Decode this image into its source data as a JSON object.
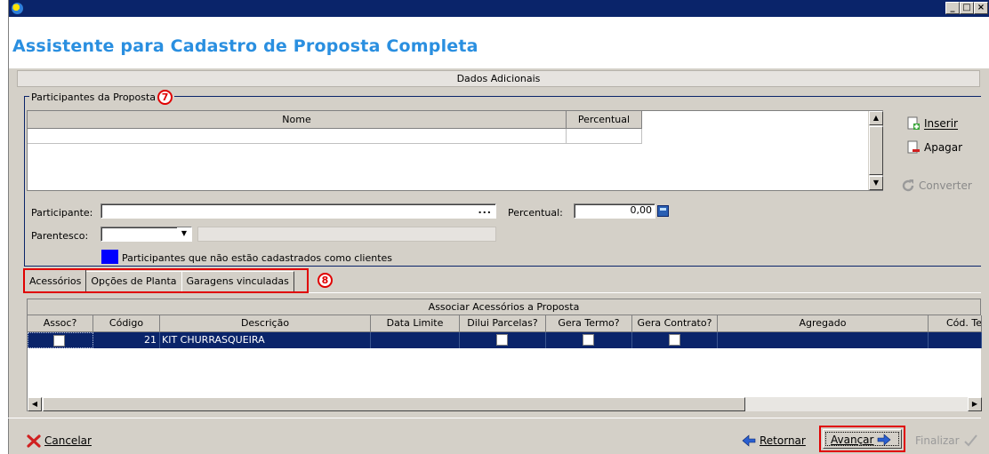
{
  "window": {
    "title": "Assistente para Cadastro de Proposta Completa",
    "controls": [
      "_",
      "□",
      "×"
    ]
  },
  "section": {
    "title": "Dados Adicionais"
  },
  "participants": {
    "legend": "Participantes da Proposta",
    "badge": "7",
    "columns": [
      "Nome",
      "Percentual"
    ],
    "actions": {
      "insert": "Inserir",
      "delete": "Apagar",
      "convert": "Converter"
    },
    "form": {
      "participant_label": "Participante:",
      "participant_value": "",
      "browse": "...",
      "percent_label": "Percentual:",
      "percent_value": "0,00",
      "kinship_label": "Parentesco:",
      "kinship_value": ""
    },
    "legend_note": "Participantes que não estão cadastrados como clientes",
    "legend_color": "#0000ff"
  },
  "tabs": {
    "items": [
      "Acessórios",
      "Opções de Planta",
      "Garagens vinculadas"
    ],
    "active": 0,
    "badge": "8"
  },
  "accessories": {
    "title": "Associar Acessórios a Proposta",
    "columns": [
      "Assoc?",
      "Código",
      "Descrição",
      "Data Limite",
      "Dilui Parcelas?",
      "Gera Termo?",
      "Gera Contrato?",
      "Agregado",
      "Cód. Ter"
    ],
    "rows": [
      {
        "codigo": "21",
        "descricao": "KIT CHURRASQUEIRA",
        "data_limite": "",
        "agregado": ""
      }
    ]
  },
  "footer": {
    "cancel": "Cancelar",
    "back": "Retornar",
    "next": "Avançar",
    "finish": "Finalizar"
  },
  "colors": {
    "accent": "#2a8fe0",
    "titlebar": "#0a246a",
    "selection": "#0a246a",
    "highlight": "#e00000"
  }
}
